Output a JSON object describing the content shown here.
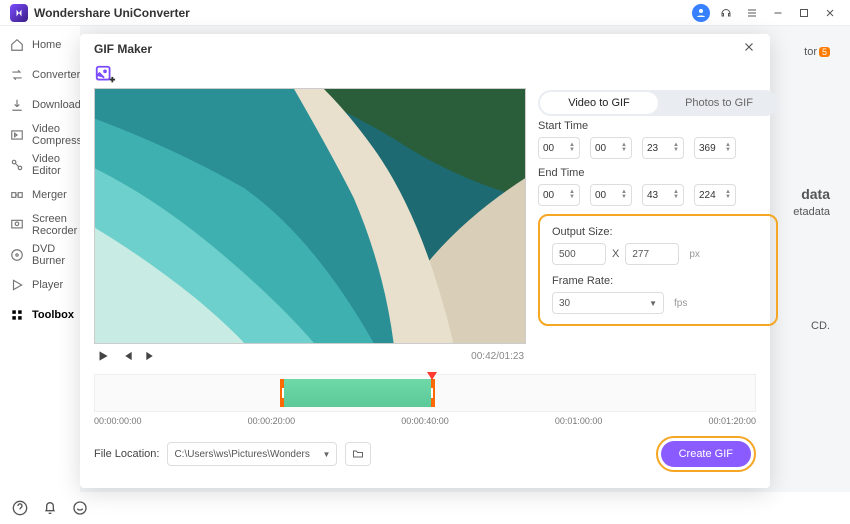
{
  "titlebar": {
    "appName": "Wondershare UniConverter"
  },
  "sidebar": {
    "items": [
      {
        "icon": "home",
        "label": "Home"
      },
      {
        "icon": "convert",
        "label": "Converter"
      },
      {
        "icon": "download",
        "label": "Downloader"
      },
      {
        "icon": "compress",
        "label": "Video Compressor"
      },
      {
        "icon": "edit",
        "label": "Video Editor"
      },
      {
        "icon": "merge",
        "label": "Merger"
      },
      {
        "icon": "record",
        "label": "Screen Recorder"
      },
      {
        "icon": "dvd",
        "label": "DVD Burner"
      },
      {
        "icon": "player",
        "label": "Player"
      },
      {
        "icon": "toolbox",
        "label": "Toolbox"
      }
    ]
  },
  "bg": {
    "rTag": "tor",
    "badge": "5",
    "meta1": "data",
    "meta2": "etadata",
    "meta3": "CD."
  },
  "modal": {
    "title": "GIF Maker",
    "tabs": {
      "video": "Video to GIF",
      "photos": "Photos to GIF"
    },
    "startLabel": "Start Time",
    "endLabel": "End Time",
    "start": {
      "h": "00",
      "m": "00",
      "s": "23",
      "ms": "369"
    },
    "end": {
      "h": "00",
      "m": "00",
      "s": "43",
      "ms": "224"
    },
    "outputSizeLabel": "Output Size:",
    "outputW": "500",
    "outputH": "277",
    "x": "X",
    "px": "px",
    "frameRateLabel": "Frame Rate:",
    "frameRate": "30",
    "fps": "fps",
    "playerTime": "00:42/01:23",
    "ticks": [
      "00:00:00:00",
      "00:00:20:00",
      "00:00:40:00",
      "00:01:00:00",
      "00:01:20:00"
    ],
    "fileLocLabel": "File Location:",
    "filePath": "C:\\Users\\ws\\Pictures\\Wonders",
    "createBtn": "Create GIF"
  }
}
